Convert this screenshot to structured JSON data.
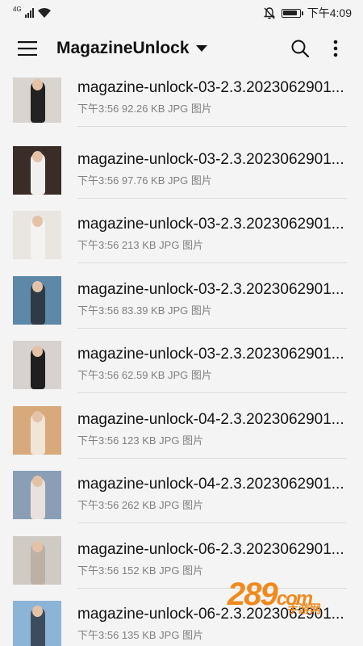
{
  "status": {
    "network": "4G",
    "time": "下午4:09"
  },
  "toolbar": {
    "title": "MagazineUnlock",
    "menu_icon": "menu-icon",
    "search_icon": "search-icon",
    "more_icon": "more-vert-icon"
  },
  "files": [
    {
      "name": "magazine-unlock-03-2.3.2023062901...",
      "meta": "下午3:56 92.26 KB JPG 图片",
      "bg": "#d9d4cf",
      "fig": "#222222"
    },
    {
      "name": "magazine-unlock-03-2.3.2023062901...",
      "meta": "下午3:56 97.76 KB JPG 图片",
      "bg": "#3a2d28",
      "fig": "#f2f0ee"
    },
    {
      "name": "magazine-unlock-03-2.3.2023062901...",
      "meta": "下午3:56 213 KB JPG 图片",
      "bg": "#e9e6e2",
      "fig": "#f5f3f1"
    },
    {
      "name": "magazine-unlock-03-2.3.2023062901...",
      "meta": "下午3:56 83.39 KB JPG 图片",
      "bg": "#5d88a8",
      "fig": "#2e3a46"
    },
    {
      "name": "magazine-unlock-03-2.3.2023062901...",
      "meta": "下午3:56 62.59 KB JPG 图片",
      "bg": "#d7d2cf",
      "fig": "#1f1f1f"
    },
    {
      "name": "magazine-unlock-04-2.3.2023062901...",
      "meta": "下午3:56 123 KB JPG 图片",
      "bg": "#d8a97a",
      "fig": "#f1e5d8"
    },
    {
      "name": "magazine-unlock-04-2.3.2023062901...",
      "meta": "下午3:56 262 KB JPG 图片",
      "bg": "#8a9fb6",
      "fig": "#e9e2dc"
    },
    {
      "name": "magazine-unlock-06-2.3.2023062901...",
      "meta": "下午3:56 152 KB JPG 图片",
      "bg": "#cfcac4",
      "fig": "#bdb0a4"
    },
    {
      "name": "magazine-unlock-06-2.3.2023062901...",
      "meta": "下午3:56 135 KB JPG 图片",
      "bg": "#8bb4d6",
      "fig": "#3d4c5c"
    }
  ],
  "watermark": {
    "num": "289",
    "suffix": "com",
    "sub": "手游网"
  }
}
